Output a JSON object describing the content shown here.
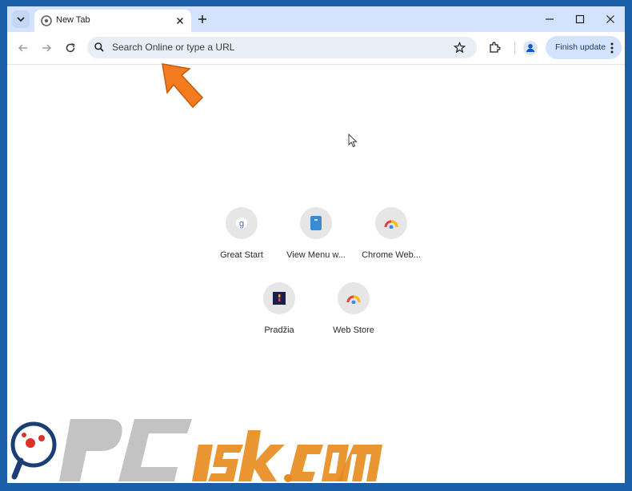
{
  "tab": {
    "title": "New Tab"
  },
  "omnibox": {
    "placeholder": "Search Online or type a URL"
  },
  "toolbar": {
    "finish_update_label": "Finish update"
  },
  "shortcuts": [
    {
      "label": "Great Start",
      "icon": "great-start-icon"
    },
    {
      "label": "View Menu w...",
      "icon": "view-menu-icon"
    },
    {
      "label": "Chrome Web...",
      "icon": "chrome-web-store-icon"
    },
    {
      "label": "Pradžia",
      "icon": "pradzia-icon"
    },
    {
      "label": "Web Store",
      "icon": "web-store-icon"
    }
  ],
  "watermark": {
    "text": "PCrisk.com"
  },
  "colors": {
    "tabstrip": "#d3e3fd",
    "omnibox": "#e9eef6",
    "accent": "#0b57d0",
    "arrow": "#f47b20",
    "frame": "#1a5fa8"
  }
}
